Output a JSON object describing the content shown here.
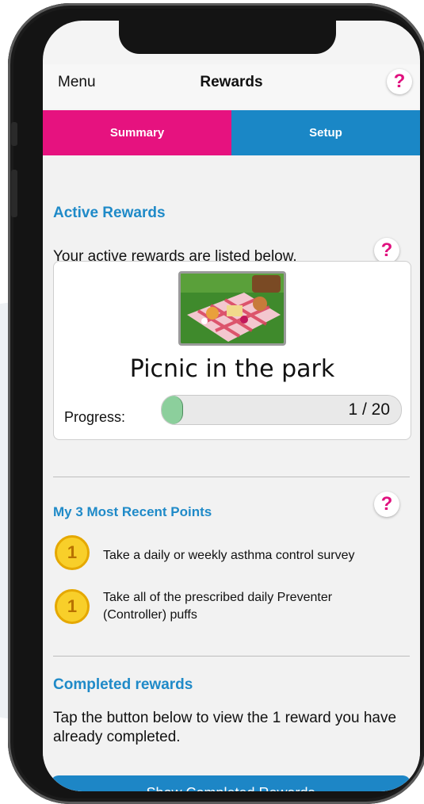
{
  "nav": {
    "menu_label": "Menu",
    "title": "Rewards",
    "help_icon": "?"
  },
  "tabs": [
    {
      "label": "Summary",
      "active": true
    },
    {
      "label": "Setup",
      "active": false
    }
  ],
  "active_rewards": {
    "title": "Active Rewards",
    "description": "Your active rewards are listed below.",
    "help_icon": "?",
    "reward": {
      "name": "Picnic in the park",
      "image_icon": "picnic-photo",
      "progress_label": "Progress:",
      "progress_text": "1 / 20",
      "progress_current": 1,
      "progress_total": 20
    }
  },
  "recent_points": {
    "title": "My 3 Most Recent Points",
    "help_icon": "?",
    "items": [
      {
        "points": "1",
        "text": "Take a daily or weekly asthma control survey"
      },
      {
        "points": "1",
        "text": "Take all of the prescribed daily Preventer (Controller) puffs"
      }
    ]
  },
  "completed_rewards": {
    "title": "Completed rewards",
    "description": "Tap the button below to view the 1 reward you have already completed.",
    "button_label": "Show Completed Rewards"
  },
  "colors": {
    "accent_pink": "#e6127f",
    "accent_blue": "#1a87c6",
    "progress_green": "#8ccf9c",
    "coin_yellow": "#f8cf2a"
  }
}
